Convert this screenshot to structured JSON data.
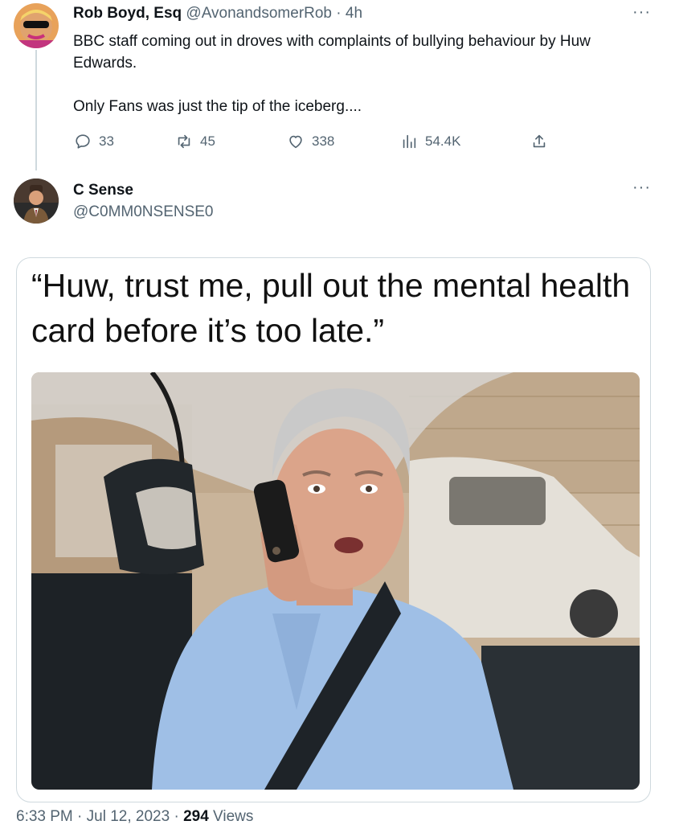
{
  "tweet1": {
    "display_name": "Rob Boyd, Esq",
    "handle": "@AvonandsomerRob",
    "separator": "·",
    "time_ago": "4h",
    "more": "···",
    "body_line1": "BBC staff coming out in droves with complaints of bullying behaviour by Huw Edwards.",
    "body_line2": "Only Fans was just the tip of the iceberg....",
    "actions": {
      "replies": "33",
      "retweets": "45",
      "likes": "338",
      "views": "54.4K"
    }
  },
  "tweet2": {
    "display_name": "C Sense",
    "handle": "@C0MM0NSENSE0",
    "more": "···",
    "caption": "“Huw, trust me, pull out the mental health card before it’s too late.”",
    "timestamp": "6:33 PM · Jul 12, 2023 · ",
    "views_count": "294",
    "views_label": " Views"
  },
  "icons": {
    "reply": "reply-icon",
    "retweet": "retweet-icon",
    "like": "heart-icon",
    "views": "analytics-icon",
    "share": "share-icon"
  },
  "colors": {
    "text_primary": "#0f1419",
    "text_secondary": "#536471",
    "border": "#cfd9de"
  }
}
